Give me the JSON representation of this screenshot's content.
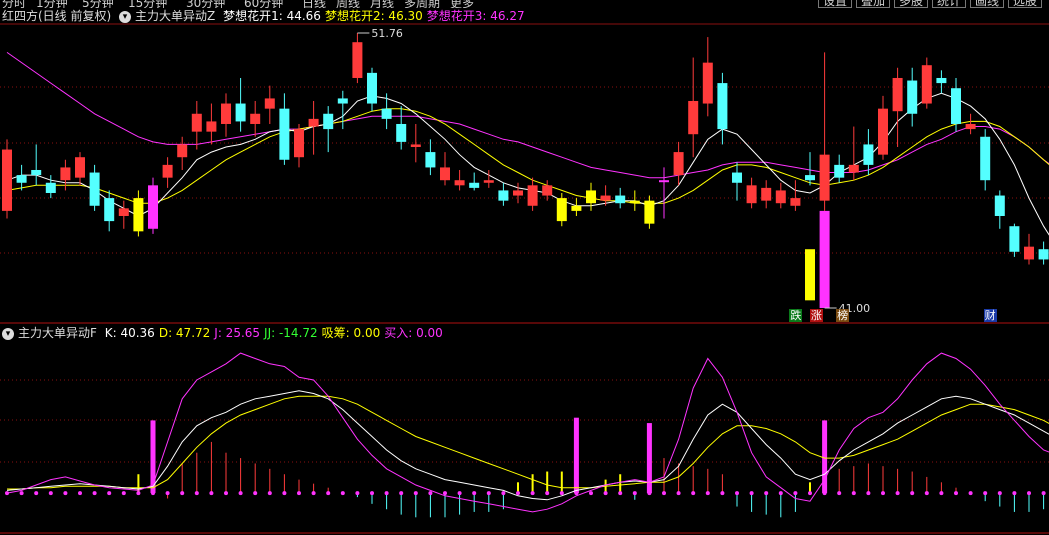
{
  "toolbar": {
    "periods": [
      "分时",
      "1分钟",
      "5分钟",
      "15分钟",
      "30分钟",
      "60分钟",
      "日线",
      "周线",
      "月线",
      "多周期",
      "更多"
    ],
    "buttons": [
      "设置",
      "叠加",
      "多股",
      "统计",
      "画线",
      "选股"
    ]
  },
  "main_panel": {
    "title": "红四方(日线 前复权)",
    "indicator": "主力大单异动Z",
    "items": [
      {
        "label": "梦想花开1: 44.66",
        "color": "#ffffff"
      },
      {
        "label": "梦想花开2: 46.30",
        "color": "#ffff00"
      },
      {
        "label": "梦想花开3: 46.27",
        "color": "#ff33ff"
      }
    ],
    "high_label": "51.76",
    "low_label": "41.00",
    "tags": [
      {
        "text": "跌",
        "bg": "#0a7a1a",
        "color": "#ffffff"
      },
      {
        "text": "涨",
        "bg": "#b01010",
        "color": "#ffffff"
      },
      {
        "text": "榜",
        "bg": "#7a4a10",
        "color": "#ffffff"
      },
      {
        "text": "财",
        "bg": "#1a3aa8",
        "color": "#ffffff"
      }
    ]
  },
  "sub_panel": {
    "indicator": "主力大单异动F",
    "items": [
      {
        "label": "K: 40.36",
        "color": "#ffffff"
      },
      {
        "label": "D: 47.72",
        "color": "#ffff00"
      },
      {
        "label": "J: 25.65",
        "color": "#ff33ff"
      },
      {
        "label": "JJ: -14.72",
        "color": "#33ff33"
      },
      {
        "label": "吸筹: 0.00",
        "color": "#ffff00"
      },
      {
        "label": "买入: 0.00",
        "color": "#ff33ff"
      }
    ]
  },
  "colors": {
    "up": "#ff3b3b",
    "down": "#54ffff",
    "yellow": "#ffff00",
    "magenta": "#ff33ff",
    "grid": "#8a1010"
  },
  "chart_data": {
    "type": "candlestick",
    "price_range": [
      41.0,
      51.76
    ],
    "candles": [
      {
        "o": 47.2,
        "c": 44.8,
        "h": 47.6,
        "l": 44.5,
        "k": "up"
      },
      {
        "o": 45.9,
        "c": 46.2,
        "h": 46.6,
        "l": 45.6,
        "k": "down"
      },
      {
        "o": 46.4,
        "c": 46.2,
        "h": 47.4,
        "l": 45.8,
        "k": "down"
      },
      {
        "o": 45.9,
        "c": 45.5,
        "h": 46.2,
        "l": 45.3,
        "k": "down"
      },
      {
        "o": 46.0,
        "c": 46.5,
        "h": 46.8,
        "l": 45.6,
        "k": "up"
      },
      {
        "o": 46.9,
        "c": 46.1,
        "h": 47.1,
        "l": 45.8,
        "k": "up"
      },
      {
        "o": 46.3,
        "c": 45.0,
        "h": 46.6,
        "l": 44.8,
        "k": "down"
      },
      {
        "o": 45.3,
        "c": 44.4,
        "h": 45.6,
        "l": 44.0,
        "k": "down"
      },
      {
        "o": 44.9,
        "c": 44.6,
        "h": 45.2,
        "l": 44.1,
        "k": "up"
      },
      {
        "o": 45.3,
        "c": 44.0,
        "h": 45.6,
        "l": 43.8,
        "k": "yellow"
      },
      {
        "o": 44.1,
        "c": 45.8,
        "h": 46.1,
        "l": 43.9,
        "k": "magenta"
      },
      {
        "o": 46.1,
        "c": 46.6,
        "h": 46.9,
        "l": 45.7,
        "k": "up"
      },
      {
        "o": 46.9,
        "c": 47.4,
        "h": 47.7,
        "l": 46.4,
        "k": "up"
      },
      {
        "o": 47.9,
        "c": 48.6,
        "h": 49.1,
        "l": 47.2,
        "k": "up"
      },
      {
        "o": 48.3,
        "c": 47.9,
        "h": 49.0,
        "l": 47.4,
        "k": "up"
      },
      {
        "o": 48.2,
        "c": 49.0,
        "h": 49.4,
        "l": 47.7,
        "k": "up"
      },
      {
        "o": 49.0,
        "c": 48.3,
        "h": 50.0,
        "l": 47.9,
        "k": "down"
      },
      {
        "o": 48.6,
        "c": 48.2,
        "h": 49.1,
        "l": 47.7,
        "k": "up"
      },
      {
        "o": 48.8,
        "c": 49.2,
        "h": 49.7,
        "l": 48.2,
        "k": "up"
      },
      {
        "o": 48.8,
        "c": 46.8,
        "h": 49.4,
        "l": 46.6,
        "k": "down"
      },
      {
        "o": 46.9,
        "c": 48.0,
        "h": 48.2,
        "l": 46.5,
        "k": "up"
      },
      {
        "o": 48.1,
        "c": 48.4,
        "h": 49.1,
        "l": 47.0,
        "k": "up"
      },
      {
        "o": 48.0,
        "c": 48.6,
        "h": 48.9,
        "l": 47.1,
        "k": "down"
      },
      {
        "o": 49.0,
        "c": 49.2,
        "h": 49.5,
        "l": 48.0,
        "k": "down"
      },
      {
        "o": 50.0,
        "c": 51.4,
        "h": 51.76,
        "l": 49.8,
        "k": "up"
      },
      {
        "o": 50.2,
        "c": 49.0,
        "h": 50.4,
        "l": 48.7,
        "k": "down"
      },
      {
        "o": 48.8,
        "c": 48.4,
        "h": 49.4,
        "l": 48.0,
        "k": "down"
      },
      {
        "o": 48.2,
        "c": 47.5,
        "h": 48.9,
        "l": 47.2,
        "k": "down"
      },
      {
        "o": 47.4,
        "c": 47.3,
        "h": 48.2,
        "l": 46.7,
        "k": "up"
      },
      {
        "o": 47.1,
        "c": 46.5,
        "h": 47.6,
        "l": 46.2,
        "k": "down"
      },
      {
        "o": 46.5,
        "c": 46.0,
        "h": 47.1,
        "l": 45.8,
        "k": "up"
      },
      {
        "o": 46.0,
        "c": 45.8,
        "h": 46.4,
        "l": 45.6,
        "k": "up"
      },
      {
        "o": 45.9,
        "c": 45.7,
        "h": 46.3,
        "l": 45.6,
        "k": "down"
      },
      {
        "o": 46.0,
        "c": 45.9,
        "h": 46.4,
        "l": 45.7,
        "k": "up"
      },
      {
        "o": 45.6,
        "c": 45.2,
        "h": 45.9,
        "l": 45.0,
        "k": "down"
      },
      {
        "o": 45.6,
        "c": 45.4,
        "h": 45.9,
        "l": 45.1,
        "k": "up"
      },
      {
        "o": 45.0,
        "c": 45.8,
        "h": 46.1,
        "l": 44.8,
        "k": "up"
      },
      {
        "o": 45.8,
        "c": 45.4,
        "h": 46.0,
        "l": 45.2,
        "k": "up"
      },
      {
        "o": 45.3,
        "c": 44.4,
        "h": 45.5,
        "l": 44.2,
        "k": "yellow"
      },
      {
        "o": 45.0,
        "c": 44.8,
        "h": 45.3,
        "l": 44.6,
        "k": "yellow"
      },
      {
        "o": 45.1,
        "c": 45.6,
        "h": 45.9,
        "l": 44.8,
        "k": "yellow"
      },
      {
        "o": 45.4,
        "c": 45.2,
        "h": 45.8,
        "l": 45.0,
        "k": "up"
      },
      {
        "o": 45.1,
        "c": 45.4,
        "h": 45.7,
        "l": 44.9,
        "k": "down"
      },
      {
        "o": 45.1,
        "c": 45.2,
        "h": 45.6,
        "l": 44.8,
        "k": "yellow"
      },
      {
        "o": 45.2,
        "c": 44.3,
        "h": 45.4,
        "l": 44.1,
        "k": "yellow"
      },
      {
        "o": 46.0,
        "c": 46.0,
        "h": 46.5,
        "l": 44.5,
        "k": "magenta"
      },
      {
        "o": 46.2,
        "c": 47.1,
        "h": 47.5,
        "l": 45.8,
        "k": "up"
      },
      {
        "o": 47.8,
        "c": 49.1,
        "h": 50.8,
        "l": 46.9,
        "k": "up"
      },
      {
        "o": 49.0,
        "c": 50.6,
        "h": 51.6,
        "l": 48.5,
        "k": "up"
      },
      {
        "o": 49.8,
        "c": 48.0,
        "h": 50.2,
        "l": 47.4,
        "k": "down"
      },
      {
        "o": 46.3,
        "c": 45.9,
        "h": 46.7,
        "l": 45.2,
        "k": "down"
      },
      {
        "o": 45.8,
        "c": 45.1,
        "h": 46.1,
        "l": 44.9,
        "k": "up"
      },
      {
        "o": 45.7,
        "c": 45.2,
        "h": 46.0,
        "l": 44.9,
        "k": "up"
      },
      {
        "o": 45.6,
        "c": 45.1,
        "h": 45.9,
        "l": 44.9,
        "k": "up"
      },
      {
        "o": 45.0,
        "c": 45.3,
        "h": 46.0,
        "l": 44.8,
        "k": "up"
      },
      {
        "o": 46.2,
        "c": 46.0,
        "h": 47.1,
        "l": 45.8,
        "k": "down"
      },
      {
        "o": 45.2,
        "c": 47.0,
        "h": 51.0,
        "l": 44.8,
        "k": "up"
      },
      {
        "o": 46.6,
        "c": 46.1,
        "h": 47.0,
        "l": 45.9,
        "k": "down"
      },
      {
        "o": 46.3,
        "c": 46.6,
        "h": 48.1,
        "l": 46.0,
        "k": "up"
      },
      {
        "o": 46.6,
        "c": 47.4,
        "h": 48.0,
        "l": 46.2,
        "k": "down"
      },
      {
        "o": 47.0,
        "c": 48.8,
        "h": 49.3,
        "l": 46.8,
        "k": "up"
      },
      {
        "o": 48.7,
        "c": 50.0,
        "h": 50.4,
        "l": 47.3,
        "k": "up"
      },
      {
        "o": 49.9,
        "c": 48.6,
        "h": 50.4,
        "l": 48.1,
        "k": "down"
      },
      {
        "o": 49.0,
        "c": 50.5,
        "h": 50.8,
        "l": 48.8,
        "k": "up"
      },
      {
        "o": 50.0,
        "c": 49.8,
        "h": 50.3,
        "l": 49.4,
        "k": "down"
      },
      {
        "o": 49.6,
        "c": 48.2,
        "h": 50.0,
        "l": 47.9,
        "k": "down"
      },
      {
        "o": 48.2,
        "c": 48.0,
        "h": 48.6,
        "l": 47.8,
        "k": "up"
      },
      {
        "o": 47.7,
        "c": 46.0,
        "h": 48.0,
        "l": 45.6,
        "k": "down"
      },
      {
        "o": 45.4,
        "c": 44.6,
        "h": 45.6,
        "l": 44.1,
        "k": "down"
      },
      {
        "o": 44.2,
        "c": 43.2,
        "h": 44.3,
        "l": 43.0,
        "k": "down"
      },
      {
        "o": 43.4,
        "c": 42.9,
        "h": 43.9,
        "l": 42.7,
        "k": "up"
      },
      {
        "o": 43.3,
        "c": 42.9,
        "h": 43.6,
        "l": 42.7,
        "k": "down"
      }
    ],
    "special_bars": [
      {
        "i": 55,
        "top": 43.3,
        "bottom": 41.3,
        "color": "yellow"
      },
      {
        "i": 56,
        "top": 44.8,
        "bottom": 41.0,
        "color": "magenta"
      }
    ],
    "ma_white": [
      46.0,
      46.2,
      46.2,
      46.0,
      45.9,
      45.9,
      45.6,
      45.2,
      44.9,
      44.6,
      44.9,
      45.5,
      46.1,
      46.8,
      47.1,
      47.3,
      47.4,
      47.6,
      47.9,
      48.0,
      47.9,
      48.1,
      48.2,
      48.5,
      49.1,
      49.3,
      49.2,
      49.0,
      48.6,
      48.1,
      47.6,
      47.0,
      46.5,
      46.2,
      45.9,
      45.7,
      45.6,
      45.5,
      45.2,
      45.0,
      45.0,
      45.1,
      45.2,
      45.2,
      45.0,
      45.2,
      45.8,
      46.7,
      47.6,
      48.0,
      47.8,
      47.2,
      46.6,
      46.0,
      45.6,
      45.5,
      45.8,
      46.3,
      46.6,
      46.9,
      47.5,
      48.3,
      48.8,
      49.2,
      49.4,
      49.2,
      48.9,
      48.4,
      47.6,
      46.6,
      45.3,
      44.2,
      43.3
    ],
    "ma_yellow": [
      45.6,
      45.7,
      45.8,
      45.8,
      45.8,
      45.8,
      45.7,
      45.5,
      45.3,
      45.1,
      45.1,
      45.3,
      45.6,
      46.0,
      46.4,
      46.8,
      47.1,
      47.4,
      47.7,
      47.9,
      48.0,
      48.1,
      48.2,
      48.3,
      48.5,
      48.7,
      48.8,
      48.8,
      48.7,
      48.5,
      48.2,
      47.8,
      47.4,
      47.0,
      46.6,
      46.3,
      46.0,
      45.8,
      45.6,
      45.4,
      45.3,
      45.2,
      45.2,
      45.1,
      45.1,
      45.1,
      45.3,
      45.6,
      46.0,
      46.4,
      46.6,
      46.6,
      46.5,
      46.3,
      46.1,
      45.9,
      45.8,
      45.9,
      46.0,
      46.2,
      46.5,
      46.9,
      47.3,
      47.7,
      48.0,
      48.2,
      48.3,
      48.3,
      48.1,
      47.7,
      47.3,
      46.8,
      46.3
    ],
    "ma_magenta": [
      51.0,
      50.6,
      50.2,
      49.8,
      49.4,
      49.0,
      48.6,
      48.3,
      48.0,
      47.7,
      47.5,
      47.4,
      47.4,
      47.4,
      47.5,
      47.6,
      47.7,
      47.8,
      47.9,
      48.0,
      48.0,
      48.1,
      48.2,
      48.3,
      48.4,
      48.5,
      48.5,
      48.5,
      48.5,
      48.4,
      48.3,
      48.2,
      48.0,
      47.8,
      47.6,
      47.5,
      47.3,
      47.1,
      46.9,
      46.7,
      46.5,
      46.4,
      46.3,
      46.2,
      46.1,
      46.1,
      46.2,
      46.3,
      46.4,
      46.6,
      46.7,
      46.7,
      46.7,
      46.6,
      46.5,
      46.4,
      46.3,
      46.3,
      46.3,
      46.4,
      46.6,
      46.8,
      47.1,
      47.4,
      47.6,
      47.9,
      48.1,
      48.1,
      48.0,
      47.7,
      47.3,
      46.8,
      46.4
    ],
    "sub_range": [
      -20,
      110
    ],
    "sub_k": [
      2,
      3,
      4,
      5,
      6,
      7,
      6,
      5,
      4,
      3,
      5,
      20,
      38,
      50,
      56,
      60,
      66,
      70,
      72,
      74,
      76,
      74,
      70,
      62,
      52,
      42,
      32,
      24,
      18,
      14,
      10,
      8,
      6,
      4,
      2,
      -2,
      -4,
      -5,
      -2,
      2,
      4,
      6,
      8,
      9,
      8,
      10,
      20,
      40,
      58,
      66,
      60,
      48,
      36,
      26,
      14,
      10,
      14,
      24,
      32,
      38,
      44,
      52,
      58,
      64,
      70,
      72,
      70,
      66,
      62,
      58,
      52,
      46,
      40
    ],
    "sub_d": [
      3,
      3,
      4,
      4,
      5,
      5,
      5,
      5,
      4,
      4,
      4,
      10,
      22,
      34,
      44,
      52,
      58,
      62,
      66,
      70,
      72,
      72,
      72,
      70,
      66,
      60,
      54,
      48,
      42,
      38,
      34,
      30,
      26,
      22,
      18,
      14,
      10,
      6,
      4,
      4,
      4,
      5,
      6,
      7,
      8,
      8,
      12,
      22,
      34,
      44,
      50,
      50,
      48,
      44,
      38,
      30,
      26,
      26,
      28,
      32,
      36,
      40,
      46,
      52,
      58,
      62,
      66,
      66,
      64,
      62,
      58,
      54,
      48
    ],
    "sub_j": [
      0,
      2,
      6,
      10,
      12,
      9,
      6,
      4,
      3,
      2,
      6,
      38,
      70,
      84,
      90,
      96,
      104,
      100,
      96,
      94,
      86,
      84,
      72,
      56,
      40,
      28,
      18,
      12,
      6,
      2,
      -2,
      -4,
      -6,
      -8,
      -10,
      -12,
      -14,
      -12,
      -8,
      -2,
      2,
      6,
      8,
      10,
      8,
      12,
      40,
      78,
      100,
      86,
      60,
      30,
      12,
      4,
      -4,
      -6,
      10,
      32,
      48,
      56,
      60,
      70,
      84,
      96,
      104,
      100,
      92,
      80,
      66,
      54,
      42,
      32,
      28
    ],
    "sub_bars": [
      {
        "i": 9,
        "v": 14,
        "c": "yellow"
      },
      {
        "i": 10,
        "v": 54,
        "c": "magenta"
      },
      {
        "i": 11,
        "v": -4,
        "c": "up"
      },
      {
        "i": 12,
        "v": 22,
        "c": "up"
      },
      {
        "i": 13,
        "v": 30,
        "c": "up"
      },
      {
        "i": 14,
        "v": 38,
        "c": "up"
      },
      {
        "i": 15,
        "v": 30,
        "c": "up"
      },
      {
        "i": 16,
        "v": 26,
        "c": "up"
      },
      {
        "i": 17,
        "v": 22,
        "c": "up"
      },
      {
        "i": 18,
        "v": 18,
        "c": "up"
      },
      {
        "i": 19,
        "v": 14,
        "c": "up"
      },
      {
        "i": 20,
        "v": 10,
        "c": "up"
      },
      {
        "i": 21,
        "v": 7,
        "c": "up"
      },
      {
        "i": 22,
        "v": 4,
        "c": "up"
      },
      {
        "i": 24,
        "v": -3,
        "c": "down"
      },
      {
        "i": 25,
        "v": -8,
        "c": "down"
      },
      {
        "i": 26,
        "v": -12,
        "c": "down"
      },
      {
        "i": 27,
        "v": -16,
        "c": "down"
      },
      {
        "i": 28,
        "v": -18,
        "c": "down"
      },
      {
        "i": 29,
        "v": -18,
        "c": "down"
      },
      {
        "i": 30,
        "v": -18,
        "c": "down"
      },
      {
        "i": 31,
        "v": -16,
        "c": "down"
      },
      {
        "i": 32,
        "v": -14,
        "c": "down"
      },
      {
        "i": 33,
        "v": -14,
        "c": "down"
      },
      {
        "i": 34,
        "v": -12,
        "c": "down"
      },
      {
        "i": 35,
        "v": 8,
        "c": "yellow"
      },
      {
        "i": 36,
        "v": 14,
        "c": "yellow"
      },
      {
        "i": 37,
        "v": 16,
        "c": "yellow"
      },
      {
        "i": 38,
        "v": 16,
        "c": "yellow"
      },
      {
        "i": 39,
        "v": 56,
        "c": "magenta"
      },
      {
        "i": 41,
        "v": 10,
        "c": "yellow"
      },
      {
        "i": 42,
        "v": 14,
        "c": "yellow"
      },
      {
        "i": 43,
        "v": -5,
        "c": "down"
      },
      {
        "i": 44,
        "v": 52,
        "c": "magenta"
      },
      {
        "i": 45,
        "v": 26,
        "c": "up"
      },
      {
        "i": 46,
        "v": 22,
        "c": "up"
      },
      {
        "i": 47,
        "v": 20,
        "c": "up"
      },
      {
        "i": 48,
        "v": 18,
        "c": "up"
      },
      {
        "i": 49,
        "v": 14,
        "c": "up"
      },
      {
        "i": 50,
        "v": -10,
        "c": "down"
      },
      {
        "i": 51,
        "v": -14,
        "c": "down"
      },
      {
        "i": 52,
        "v": -16,
        "c": "down"
      },
      {
        "i": 53,
        "v": -18,
        "c": "down"
      },
      {
        "i": 54,
        "v": -14,
        "c": "down"
      },
      {
        "i": 55,
        "v": 8,
        "c": "yellow"
      },
      {
        "i": 56,
        "v": 54,
        "c": "magenta"
      },
      {
        "i": 57,
        "v": 18,
        "c": "up"
      },
      {
        "i": 58,
        "v": 20,
        "c": "up"
      },
      {
        "i": 59,
        "v": 22,
        "c": "up"
      },
      {
        "i": 60,
        "v": 20,
        "c": "up"
      },
      {
        "i": 61,
        "v": 18,
        "c": "up"
      },
      {
        "i": 62,
        "v": 16,
        "c": "up"
      },
      {
        "i": 63,
        "v": 12,
        "c": "up"
      },
      {
        "i": 64,
        "v": 8,
        "c": "up"
      },
      {
        "i": 65,
        "v": 4,
        "c": "up"
      },
      {
        "i": 67,
        "v": -6,
        "c": "down"
      },
      {
        "i": 68,
        "v": -10,
        "c": "down"
      },
      {
        "i": 69,
        "v": -14,
        "c": "down"
      },
      {
        "i": 70,
        "v": -14,
        "c": "down"
      },
      {
        "i": 71,
        "v": -12,
        "c": "down"
      },
      {
        "i": 72,
        "v": -12,
        "c": "down"
      }
    ]
  }
}
